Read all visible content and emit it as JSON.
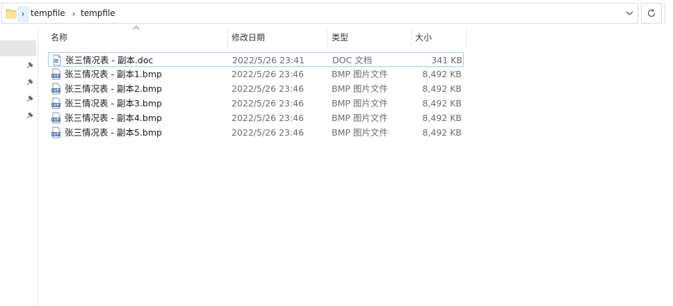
{
  "address": {
    "crumbs": [
      "tempfile",
      "tempfile"
    ],
    "chevron": "›"
  },
  "columns": {
    "name": "名称",
    "date": "修改日期",
    "type": "类型",
    "size": "大小"
  },
  "files": [
    {
      "name": "张三情况表 - 副本.doc",
      "date": "2022/5/26 23:41",
      "type": "DOC 文档",
      "size": "341 KB",
      "icon": "doc-file-icon",
      "selected": true
    },
    {
      "name": "张三情况表 - 副本1.bmp",
      "date": "2022/5/26 23:46",
      "type": "BMP 图片文件",
      "size": "8,492 KB",
      "icon": "bmp-file-icon"
    },
    {
      "name": "张三情况表 - 副本2.bmp",
      "date": "2022/5/26 23:46",
      "type": "BMP 图片文件",
      "size": "8,492 KB",
      "icon": "bmp-file-icon"
    },
    {
      "name": "张三情况表 - 副本3.bmp",
      "date": "2022/5/26 23:46",
      "type": "BMP 图片文件",
      "size": "8,492 KB",
      "icon": "bmp-file-icon"
    },
    {
      "name": "张三情况表 - 副本4.bmp",
      "date": "2022/5/26 23:46",
      "type": "BMP 图片文件",
      "size": "8,492 KB",
      "icon": "bmp-file-icon"
    },
    {
      "name": "张三情况表 - 副本5.bmp",
      "date": "2022/5/26 23:46",
      "type": "BMP 图片文件",
      "size": "8,492 KB",
      "icon": "bmp-file-icon"
    }
  ],
  "colors": {
    "selection_border": "#99d1ff",
    "folder": "#f8d775",
    "bmp_icon": "#5b7fb8"
  }
}
